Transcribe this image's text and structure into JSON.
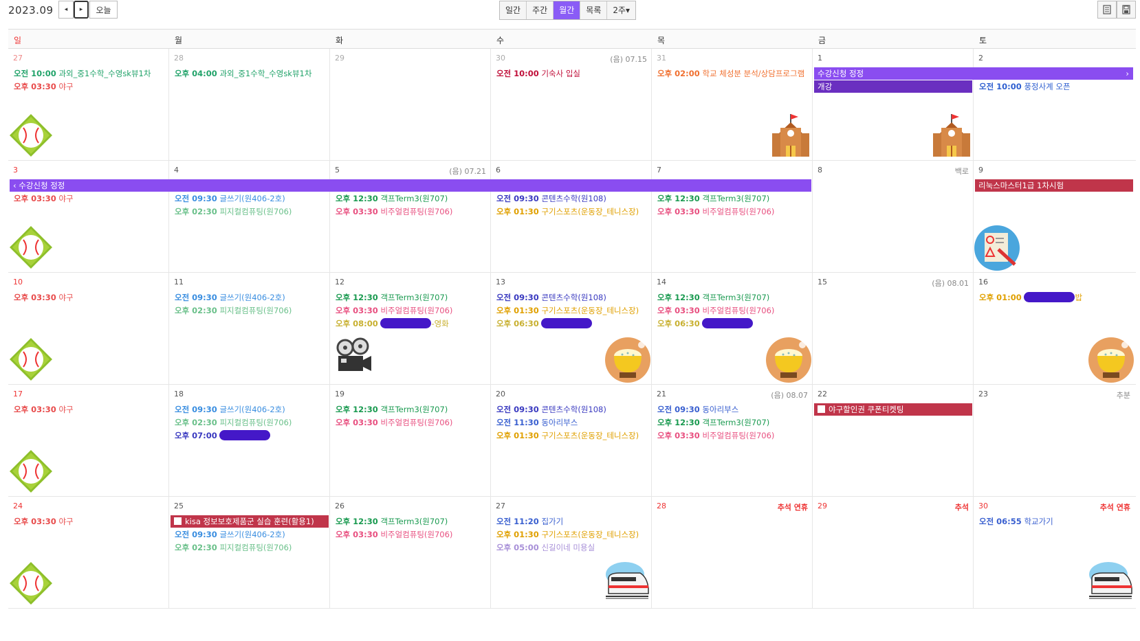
{
  "toolbar": {
    "title": "2023.09",
    "prev_label": "◂",
    "next_label": "▸",
    "today_label": "오늘",
    "views": [
      "일간",
      "주간",
      "월간",
      "목록",
      "2주▾"
    ],
    "active_view": "월간"
  },
  "weekdays": [
    "일",
    "월",
    "화",
    "수",
    "목",
    "금",
    "토"
  ],
  "colors": {
    "accent": "#8a5cf6",
    "sunday": "#e33333",
    "bar_purple": "#8a4df0",
    "bar_darkpurple": "#6a2fc0",
    "bar_red": "#c0354a",
    "redact": "#4418c8"
  },
  "weeks": [
    {
      "days": [
        {
          "num": "27",
          "note": "",
          "events": [
            {
              "time": "오전 10:00",
              "text": "과외_중1수학_수영sk뷰1차",
              "color": "#22a36a"
            },
            {
              "time": "오후 03:30",
              "text": "야구",
              "color": "#e84c4c"
            }
          ],
          "icon": "baseball-icon"
        },
        {
          "num": "28",
          "note": "",
          "events": [
            {
              "time": "오후 04:00",
              "text": "과외_중1수학_수영sk뷰1차",
              "color": "#22a36a"
            }
          ],
          "icon": ""
        },
        {
          "num": "29",
          "note": "",
          "events": [],
          "icon": ""
        },
        {
          "num": "30",
          "note": "(음) 07.15",
          "events": [
            {
              "time": "오전 10:00",
              "text": "기숙사 입실",
              "color": "#c0103a"
            }
          ],
          "icon": ""
        },
        {
          "num": "31",
          "note": "",
          "events": [
            {
              "time": "오후 02:00",
              "text": "학교 체성분 분석/상담프로그램",
              "color": "#f07030"
            }
          ],
          "icon": "school-icon"
        },
        {
          "num": "1",
          "note": "",
          "events": [],
          "icon": "school-icon"
        },
        {
          "num": "2",
          "note": "",
          "events": [
            {
              "time": "오전 10:00",
              "text": "풍정사계 오픈",
              "color": "#3060d0"
            }
          ],
          "icon": ""
        }
      ],
      "bars": [
        {
          "text": "수강신청 정정",
          "color": "#8a4df0",
          "start": 5,
          "span": 2,
          "row": 0,
          "suffix": "›"
        },
        {
          "text": "개강",
          "color": "#6a2fc0",
          "start": 5,
          "span": 1,
          "row": 1
        }
      ]
    },
    {
      "days": [
        {
          "num": "3",
          "note": "",
          "events": [
            {
              "time": "오후 03:30",
              "text": "야구",
              "color": "#e84c4c"
            }
          ],
          "icon": "baseball-icon"
        },
        {
          "num": "4",
          "note": "",
          "events": [
            {
              "time": "오전 09:30",
              "text": "글쓰기(원406-2호)",
              "color": "#3a8ee0"
            },
            {
              "time": "오후 02:30",
              "text": "피지컬컴퓨팅(원706)",
              "color": "#6ac08a"
            }
          ],
          "icon": ""
        },
        {
          "num": "5",
          "note": "(음) 07.21",
          "events": [
            {
              "time": "오후 12:30",
              "text": "객프Term3(원707)",
              "color": "#1a9a50"
            },
            {
              "time": "오후 03:30",
              "text": "비주얼컴퓨팅(원706)",
              "color": "#e85080"
            }
          ],
          "icon": ""
        },
        {
          "num": "6",
          "note": "",
          "events": [
            {
              "time": "오전 09:30",
              "text": "콘텐츠수학(원108)",
              "color": "#3a3ac0"
            },
            {
              "time": "오후 01:30",
              "text": "구기스포츠(운동장_테니스장)",
              "color": "#e0a000"
            }
          ],
          "icon": ""
        },
        {
          "num": "7",
          "note": "",
          "events": [
            {
              "time": "오후 12:30",
              "text": "객프Term3(원707)",
              "color": "#1a9a50"
            },
            {
              "time": "오후 03:30",
              "text": "비주얼컴퓨팅(원706)",
              "color": "#e85080"
            }
          ],
          "icon": ""
        },
        {
          "num": "8",
          "note": "백로",
          "events": [],
          "icon": ""
        },
        {
          "num": "9",
          "note": "",
          "events": [],
          "icon": "exam-icon"
        }
      ],
      "bars": [
        {
          "text": "‹ 수강신청 정정",
          "color": "#8a4df0",
          "start": 0,
          "span": 5,
          "row": 0
        },
        {
          "text": "리눅스마스터1급 1차시험",
          "color": "#c0354a",
          "start": 6,
          "span": 1,
          "row": 0
        }
      ]
    },
    {
      "days": [
        {
          "num": "10",
          "note": "",
          "events": [
            {
              "time": "오후 03:30",
              "text": "야구",
              "color": "#e84c4c"
            }
          ],
          "icon": "baseball-icon"
        },
        {
          "num": "11",
          "note": "",
          "events": [
            {
              "time": "오전 09:30",
              "text": "글쓰기(원406-2호)",
              "color": "#3a8ee0"
            },
            {
              "time": "오후 02:30",
              "text": "피지컬컴퓨팅(원706)",
              "color": "#6ac08a"
            }
          ],
          "icon": ""
        },
        {
          "num": "12",
          "note": "",
          "events": [
            {
              "time": "오후 12:30",
              "text": "객프Term3(원707)",
              "color": "#1a9a50"
            },
            {
              "time": "오후 03:30",
              "text": "비주얼컴퓨팅(원706)",
              "color": "#e85080"
            },
            {
              "time": "오후 08:00",
              "text": "-영화",
              "color": "#c8b030",
              "redact": true
            }
          ],
          "icon": "projector-icon"
        },
        {
          "num": "13",
          "note": "",
          "events": [
            {
              "time": "오전 09:30",
              "text": "콘텐츠수학(원108)",
              "color": "#3a3ac0"
            },
            {
              "time": "오후 01:30",
              "text": "구기스포츠(운동장_테니스장)",
              "color": "#e0a000"
            },
            {
              "time": "오후 06:30",
              "text": "",
              "color": "#c8b030",
              "redact": true
            }
          ],
          "icon": "rice-icon"
        },
        {
          "num": "14",
          "note": "",
          "events": [
            {
              "time": "오후 12:30",
              "text": "객프Term3(원707)",
              "color": "#1a9a50"
            },
            {
              "time": "오후 03:30",
              "text": "비주얼컴퓨팅(원706)",
              "color": "#e85080"
            },
            {
              "time": "오후 06:30",
              "text": "",
              "color": "#c8b030",
              "redact": true
            }
          ],
          "icon": "rice-icon"
        },
        {
          "num": "15",
          "note": "(음) 08.01",
          "events": [],
          "icon": ""
        },
        {
          "num": "16",
          "note": "",
          "events": [
            {
              "time": "오후 01:00",
              "text": "밥",
              "color": "#e0a000",
              "redact": true
            }
          ],
          "icon": "rice-icon"
        }
      ],
      "bars": []
    },
    {
      "days": [
        {
          "num": "17",
          "note": "",
          "events": [
            {
              "time": "오후 03:30",
              "text": "야구",
              "color": "#e84c4c"
            }
          ],
          "icon": "baseball-icon"
        },
        {
          "num": "18",
          "note": "",
          "events": [
            {
              "time": "오전 09:30",
              "text": "글쓰기(원406-2호)",
              "color": "#3a8ee0"
            },
            {
              "time": "오후 02:30",
              "text": "피지컬컴퓨팅(원706)",
              "color": "#6ac08a"
            },
            {
              "time": "오후 07:00",
              "text": "",
              "color": "#3a3ac0",
              "redact": true
            }
          ],
          "icon": ""
        },
        {
          "num": "19",
          "note": "",
          "events": [
            {
              "time": "오후 12:30",
              "text": "객프Term3(원707)",
              "color": "#1a9a50"
            },
            {
              "time": "오후 03:30",
              "text": "비주얼컴퓨팅(원706)",
              "color": "#e85080"
            }
          ],
          "icon": ""
        },
        {
          "num": "20",
          "note": "",
          "events": [
            {
              "time": "오전 09:30",
              "text": "콘텐츠수학(원108)",
              "color": "#3a3ac0"
            },
            {
              "time": "오전 11:30",
              "text": "동아리부스",
              "color": "#3a60d0"
            },
            {
              "time": "오후 01:30",
              "text": "구기스포츠(운동장_테니스장)",
              "color": "#e0a000"
            }
          ],
          "icon": ""
        },
        {
          "num": "21",
          "note": "(음) 08.07",
          "events": [
            {
              "time": "오전 09:30",
              "text": "동아리부스",
              "color": "#3a60d0"
            },
            {
              "time": "오후 12:30",
              "text": "객프Term3(원707)",
              "color": "#1a9a50"
            },
            {
              "time": "오후 03:30",
              "text": "비주얼컴퓨팅(원706)",
              "color": "#e85080"
            }
          ],
          "icon": ""
        },
        {
          "num": "22",
          "note": "",
          "events": [],
          "icon": ""
        },
        {
          "num": "23",
          "note": "추분",
          "events": [],
          "icon": ""
        }
      ],
      "bars": [
        {
          "text": "야구할인권 쿠폰티켓팅",
          "color": "#c0354a",
          "start": 5,
          "span": 1,
          "row": 0,
          "checkbox": true
        }
      ]
    },
    {
      "days": [
        {
          "num": "24",
          "note": "",
          "events": [
            {
              "time": "오후 03:30",
              "text": "야구",
              "color": "#e84c4c"
            }
          ],
          "icon": "baseball-icon"
        },
        {
          "num": "25",
          "note": "",
          "events": [
            {
              "time": "",
              "text": "",
              "color": "#000"
            },
            {
              "time": "오전 09:30",
              "text": "글쓰기(원406-2호)",
              "color": "#3a8ee0"
            },
            {
              "time": "오후 02:30",
              "text": "피지컬컴퓨팅(원706)",
              "color": "#6ac08a"
            }
          ],
          "icon": ""
        },
        {
          "num": "26",
          "note": "",
          "events": [
            {
              "time": "오후 12:30",
              "text": "객프Term3(원707)",
              "color": "#1a9a50"
            },
            {
              "time": "오후 03:30",
              "text": "비주얼컴퓨팅(원706)",
              "color": "#e85080"
            }
          ],
          "icon": ""
        },
        {
          "num": "27",
          "note": "",
          "events": [
            {
              "time": "오전 11:20",
              "text": "집가기",
              "color": "#3a60d0"
            },
            {
              "time": "오후 01:30",
              "text": "구기스포츠(운동장_테니스장)",
              "color": "#e0a000"
            },
            {
              "time": "오후 05:00",
              "text": "신길이네 미용실",
              "color": "#a890d8"
            }
          ],
          "icon": "train-icon"
        },
        {
          "num": "28",
          "note": "추석 연휴",
          "events": [],
          "icon": ""
        },
        {
          "num": "29",
          "note": "추석",
          "events": [],
          "icon": ""
        },
        {
          "num": "30",
          "note": "추석 연휴",
          "events": [
            {
              "time": "오전 06:55",
              "text": "학교가기",
              "color": "#3a60d0"
            }
          ],
          "icon": "train-icon"
        }
      ],
      "bars": [
        {
          "text": "kisa 정보보호제품군 실습 훈련(활용1)",
          "color": "#c0354a",
          "start": 1,
          "span": 1,
          "row": 0,
          "checkbox": true
        }
      ]
    }
  ]
}
